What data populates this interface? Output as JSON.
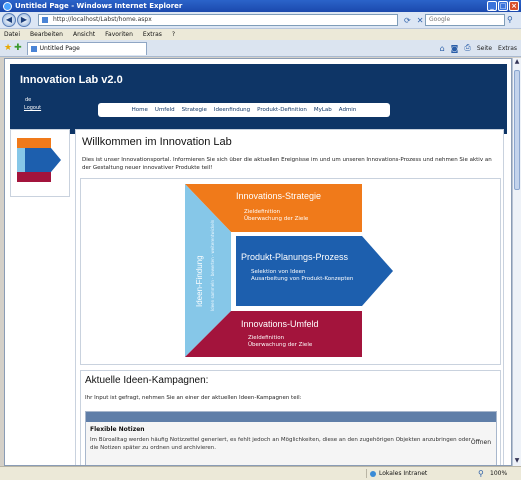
{
  "window": {
    "title": "Untitled Page - Windows Internet Explorer",
    "controls": {
      "minimize": "_",
      "maximize": "□",
      "close": "×"
    }
  },
  "browser": {
    "address": "http://localhost/Labst/home.aspx",
    "search_placeholder": "Google",
    "menu": [
      "Datei",
      "Bearbeiten",
      "Ansicht",
      "Favoriten",
      "Extras",
      "?"
    ],
    "tab_title": "Untitled Page",
    "commands": {
      "page": "Seite",
      "tools": "Extras"
    },
    "status_zone": "Lokales Intranet",
    "zoom": "100%"
  },
  "header": {
    "brand": "Innovation Lab v2.0",
    "user": "de",
    "logout": "Logout",
    "nav": [
      "Home",
      "Umfeld",
      "Strategie",
      "Ideenfindung",
      "Produkt-Definition",
      "MyLab",
      "Admin"
    ]
  },
  "content": {
    "title": "Willkommen im Innovation Lab",
    "intro": "Dies ist unser Innovationsportal. Informieren Sie sich über die aktuellen Ereignisse im und um unseren Innovations-Prozess und nehmen Sie aktiv an der Gestaltung neuer innovativer Produkte teil!"
  },
  "diagram": {
    "strategy": {
      "title": "Innovations-Strategie",
      "line1": "Zieldefinition",
      "line2": "Überwachung der Ziele",
      "color": "#f07a1a"
    },
    "planning": {
      "title": "Produkt-Planungs-Prozess",
      "line1": "Selektion von Ideen",
      "line2": "Ausarbeitung von Produkt-Konzepten",
      "color": "#1d5fae"
    },
    "environment": {
      "title": "Innovations-Umfeld",
      "line1": "Zieldefinition",
      "line2": "Überwachung der Ziele",
      "color": "#a3143c"
    },
    "ideas": {
      "title": "Ideen-Findung",
      "subtitle": "Ideen sammeln · bewerten · weiterentwickeln",
      "color": "#86c7e8"
    }
  },
  "campaigns": {
    "title": "Aktuelle Ideen-Kampagnen:",
    "intro": "Ihr Input ist gefragt, nehmen Sie an einer der aktuellen Ideen-Kampagnen teil:",
    "items": [
      {
        "title": "Flexible Notizen",
        "description": "Im Büroalltag werden häufig Notizzettel generiert, es fehlt jedoch an Möglichkeiten, diese an den zugehörigen Objekten anzubringen oder die Notizen später zu ordnen und archivieren.",
        "action": "Öffnen"
      }
    ]
  },
  "colors": {
    "header_bg": "#0e3566",
    "accent_blue": "#1d5fae"
  }
}
